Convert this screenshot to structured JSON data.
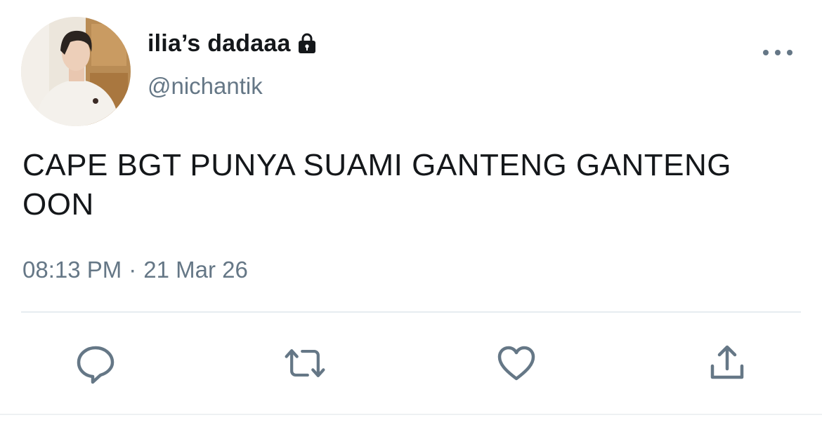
{
  "user": {
    "display_name": "ilia’s dadaaa",
    "handle": "@nichantik",
    "protected": true,
    "avatar": "profile-photo"
  },
  "tweet": {
    "text": "CAPE BGT PUNYA SUAMI GANTENG GANTENG\nOON",
    "time": "08:13 PM",
    "separator": "·",
    "date": "21 Mar 26"
  },
  "icons": {
    "lock": "lock-icon",
    "more": "more-options-icon",
    "reply": "reply-icon",
    "retweet": "retweet-icon",
    "like": "heart-icon",
    "share": "share-icon"
  },
  "colors": {
    "text_primary": "#14171a",
    "text_secondary": "#657786",
    "icon": "#657786",
    "divider": "#e6ecf0"
  }
}
